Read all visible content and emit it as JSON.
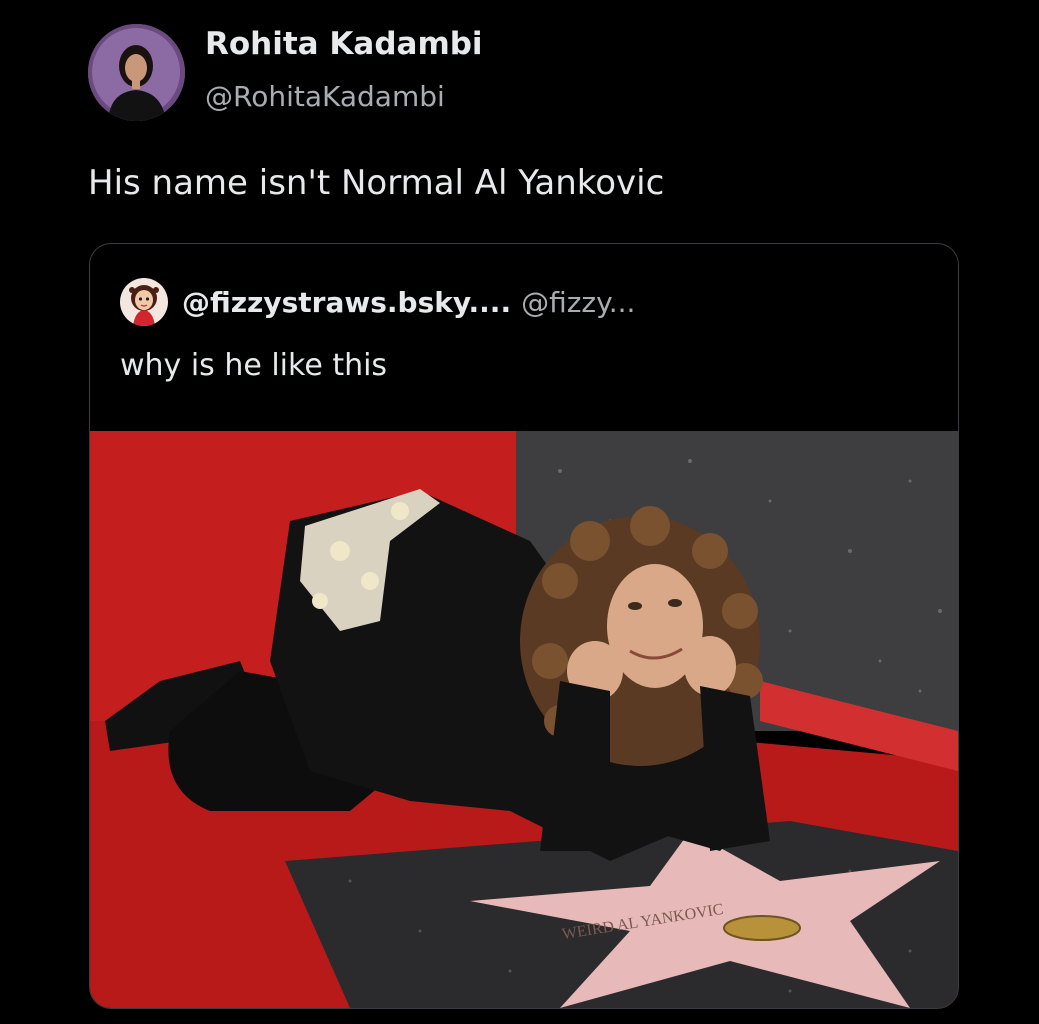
{
  "author": {
    "display_name": "Rohita Kadambi",
    "handle": "@RohitaKadambi",
    "avatar_icon": "user-avatar-photo"
  },
  "post": {
    "text": "His name isn't Normal Al Yankovic"
  },
  "quoted_post": {
    "display_name": "@fizzystraws.bsky....",
    "handle": "@fizzy...",
    "text": "why is he like this",
    "avatar_icon": "cartoon-avatar",
    "media": {
      "star_inscription": "WEIRD AL YANKOVIC"
    }
  },
  "colors": {
    "background": "#000000",
    "text_primary": "#e7e9ea",
    "text_secondary": "#a8adb2",
    "card_border": "#3a3d41",
    "carpet_red": "#c41e1e",
    "star_pink": "#e8b9b9"
  }
}
